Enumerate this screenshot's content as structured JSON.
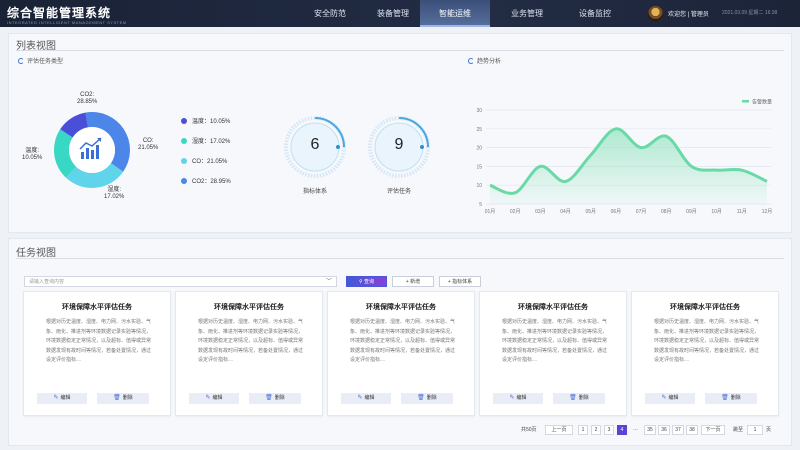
{
  "header": {
    "title": "综合智能管理系统",
    "subtitle": "INTEGRATED INTELLIGENT MANAGEMENT SYSTEM",
    "nav": [
      {
        "label": "安全防范",
        "active": false
      },
      {
        "label": "装备管理",
        "active": false
      },
      {
        "label": "智能运维",
        "active": true
      },
      {
        "label": "业务管理",
        "active": false
      },
      {
        "label": "设备监控",
        "active": false
      }
    ],
    "welcome": "欢迎您 | 管理员",
    "datetime": "2021.03.09  星期二  16:38"
  },
  "list_view": {
    "title": "列表视图",
    "pie_panel": {
      "title": "评估任务类型",
      "center_icon": "trend-chart-icon",
      "slices": [
        {
          "name": "CO2",
          "label": "CO2:\n28.85%",
          "percent": 28.85,
          "color": "#4b86e8"
        },
        {
          "name": "CO",
          "label": "CO:\n21.05%",
          "percent": 21.05,
          "color": "#5fd4ea"
        },
        {
          "name": "湿度",
          "label": "湿度:\n17.02%",
          "percent": 17.02,
          "color": "#38d8c4"
        },
        {
          "name": "温度",
          "label": "温度:\n10.05%",
          "percent": 10.05,
          "color": "#4a4fd8"
        }
      ],
      "legend": [
        {
          "label": "温度：10.05%",
          "color": "#4a4fd8"
        },
        {
          "label": "湿度：17.02%",
          "color": "#38d8c4"
        },
        {
          "label": "CO：21.05%",
          "color": "#5fd4ea"
        },
        {
          "label": "CO2：28.95%",
          "color": "#4b86e8"
        }
      ]
    },
    "gauges": [
      {
        "value": "6",
        "label": "指标体系"
      },
      {
        "value": "9",
        "label": "评估任务"
      }
    ],
    "trend_panel": {
      "title": "趋势分析"
    }
  },
  "chart_data": {
    "type": "area",
    "legend": "告警数量",
    "legend_color": "#6ad9a8",
    "categories": [
      "01月",
      "02月",
      "03月",
      "04月",
      "05月",
      "06月",
      "07月",
      "08月",
      "09月",
      "10月",
      "11月",
      "12月"
    ],
    "values": [
      10,
      8,
      15,
      11,
      18,
      25,
      20,
      23,
      15,
      14,
      14,
      11
    ],
    "ylim": [
      5,
      30
    ],
    "yticks": [
      5,
      10,
      15,
      20,
      25,
      30
    ],
    "grid": true
  },
  "task_view": {
    "title": "任务视图",
    "search_placeholder": "请输入查询内容",
    "search_chevron": "﹀",
    "buttons": {
      "query": "查询",
      "add": "新增",
      "indicator": "指标体系"
    },
    "cards": [
      {
        "title": "环境保障水平评估任务",
        "body": "根据对历史温度、湿度、电力网、污水实验、气象、雨化、推进剂等环境数据记录实验等情况，环境数据稳定正常情况，以及超标、值得或异常数据发现有故时间等情况，若备处置情况，通过设定评价指标…",
        "edit": "编辑",
        "delete": "删除"
      },
      {
        "title": "环境保障水平评估任务",
        "body": "根据对历史温度、湿度、电力网、污水实验、气象、雨化、推进剂等环境数据记录实验等情况，环境数据稳定正常情况，以及超标、值得或异常数据发现有故时间等情况，若备处置情况，通过设定评价指标…",
        "edit": "编辑",
        "delete": "删除"
      },
      {
        "title": "环境保障水平评估任务",
        "body": "根据对历史温度、湿度、电力网、污水实验、气象、雨化、推进剂等环境数据记录实验等情况，环境数据稳定正常情况，以及超标、值得或异常数据发现有故时间等情况，若备处置情况，通过设定评价指标…",
        "edit": "编辑",
        "delete": "删除"
      },
      {
        "title": "环境保障水平评估任务",
        "body": "根据对历史温度、湿度、电力网、污水实验、气象、雨化、推进剂等环境数据记录实验等情况，环境数据稳定正常情况，以及超标、值得或异常数据发现有故时间等情况，若备处置情况，通过设定评价指标…",
        "edit": "编辑",
        "delete": "删除"
      },
      {
        "title": "环境保障水平评估任务",
        "body": "根据对历史温度、湿度、电力网、污水实验、气象、雨化、推进剂等环境数据记录实验等情况，环境数据稳定正常情况，以及超标、值得或异常数据发现有故时间等情况，若备处置情况，通过设定评价指标…",
        "edit": "编辑",
        "delete": "删除"
      }
    ],
    "pagination": {
      "total": "共50页",
      "prev": "上一页",
      "pages_a": [
        "1",
        "2",
        "3",
        "4"
      ],
      "current": "4",
      "ellipsis": "…",
      "pages_b": [
        "35",
        "36",
        "37",
        "38"
      ],
      "next": "下一页",
      "goto": "跳至",
      "goto_value": "1",
      "goto_suffix": "页"
    }
  }
}
